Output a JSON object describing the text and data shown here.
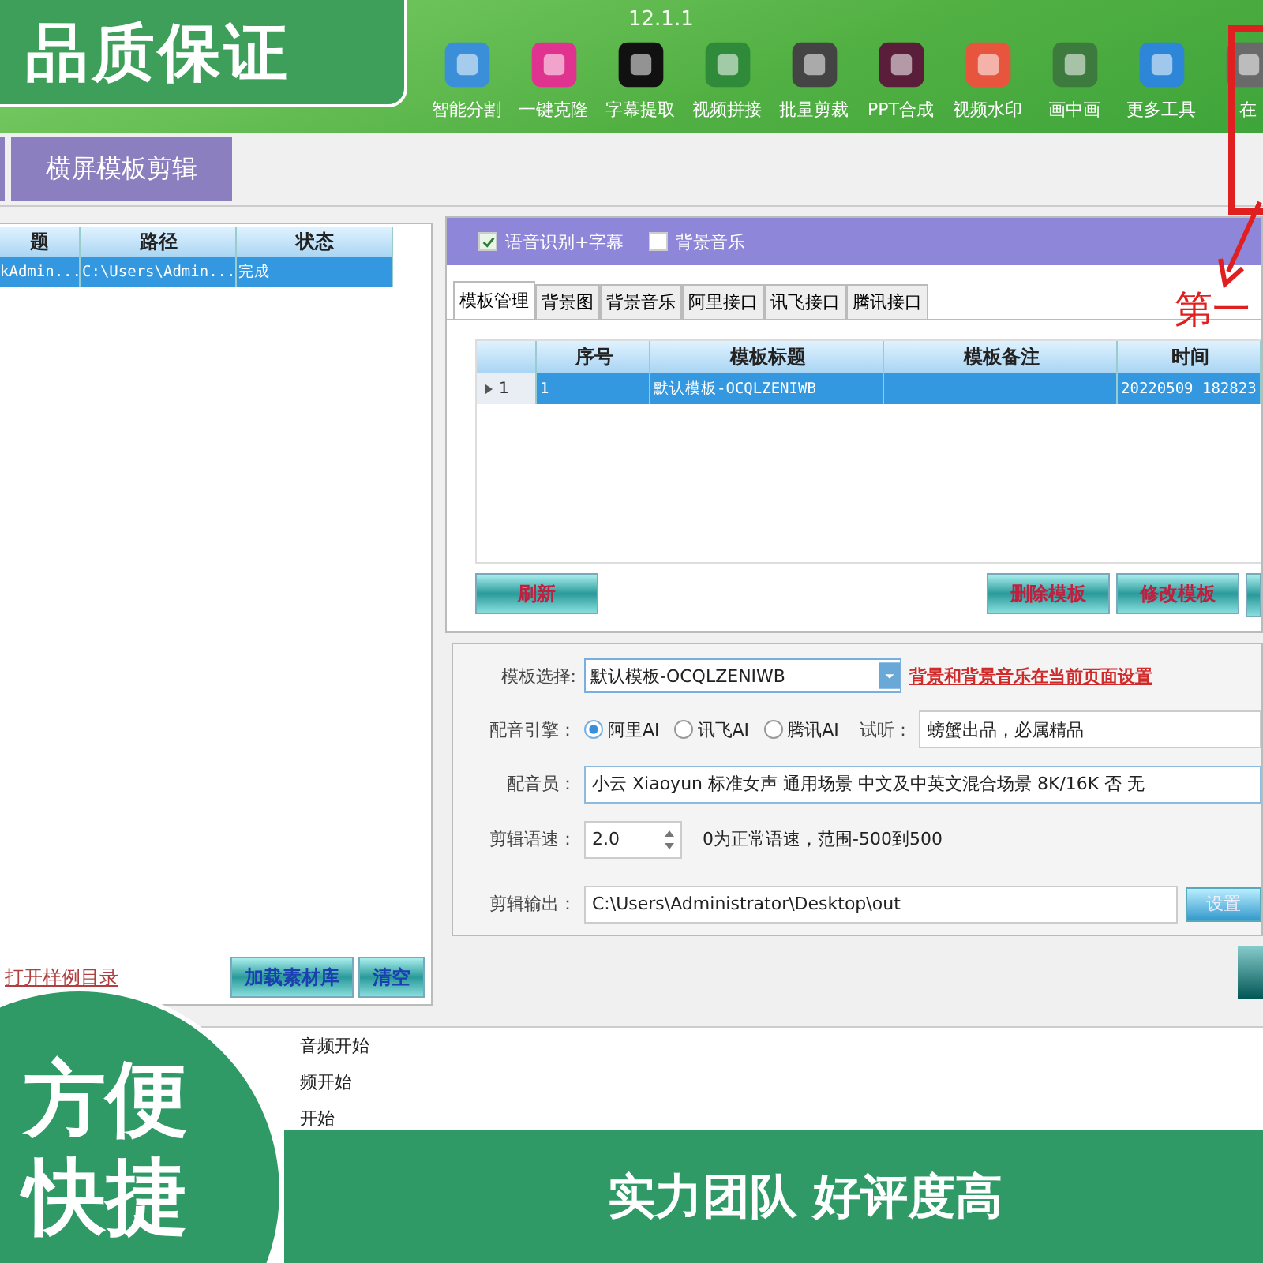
{
  "banner_top": {
    "text": "品质保证"
  },
  "toolbar": {
    "version": "12.1.1",
    "items": [
      {
        "label": "智能分割"
      },
      {
        "label": "一键克隆"
      },
      {
        "label": "字幕提取"
      },
      {
        "label": "视频拼接"
      },
      {
        "label": "批量剪裁"
      },
      {
        "label": "PPT合成"
      },
      {
        "label": "视频水印"
      },
      {
        "label": "画中画"
      },
      {
        "label": "更多工具"
      },
      {
        "label": "在"
      }
    ]
  },
  "mode_tabs": [
    {
      "label": "横屏模板剪辑",
      "selected": true
    }
  ],
  "file_table": {
    "columns": [
      "题",
      "路径",
      "状态"
    ],
    "rows": [
      {
        "cells": [
          "kAdmin...",
          "C:\\Users\\Admin...",
          "完成"
        ],
        "selected": true
      }
    ]
  },
  "sample_link": "打开样例目录",
  "file_buttons": [
    {
      "label": "加载素材库"
    },
    {
      "label": "清空"
    }
  ],
  "options": [
    {
      "label": "语音识别+字幕",
      "checked": true
    },
    {
      "label": "背景音乐",
      "checked": false
    }
  ],
  "panel_tabs": [
    {
      "label": "模板管理",
      "selected": true
    },
    {
      "label": "背景图",
      "selected": false
    },
    {
      "label": "背景音乐",
      "selected": false
    },
    {
      "label": "阿里接口",
      "selected": false
    },
    {
      "label": "讯飞接口",
      "selected": false
    },
    {
      "label": "腾讯接口",
      "selected": false
    }
  ],
  "template_table": {
    "columns": [
      "序号",
      "模板标题",
      "模板备注",
      "时间"
    ],
    "rows": [
      {
        "row_header": "1",
        "number": "1",
        "title": "默认模板-OCQLZENIWB",
        "time": "20220509 182823",
        "selected": true
      }
    ]
  },
  "template_buttons": [
    {
      "label": "刷新"
    },
    {
      "label": "删除模板"
    },
    {
      "label": "修改模板"
    }
  ],
  "template_select": {
    "label": "模板选择:",
    "value": "默认模板-OCQLZENIWB",
    "note": "背景和背景音乐在当前页面设置"
  },
  "engine": {
    "label": "配音引擎：",
    "options": [
      {
        "label": "阿里AI",
        "selected": true
      },
      {
        "label": "讯飞AI",
        "selected": false
      },
      {
        "label": "腾讯AI",
        "selected": false
      }
    ],
    "preview_label": "试听：",
    "preview_value": "螃蟹出品，必属精品"
  },
  "voice": {
    "label": "配音员：",
    "value": "小云 Xiaoyun 标准女声 通用场景 中文及中英文混合场景 8K/16K 否 无"
  },
  "speed": {
    "label": "剪辑语速：",
    "value": "2.0",
    "hint": "0为正常语速，范围-500到500"
  },
  "output": {
    "label": "剪辑输出：",
    "value": "C:\\Users\\Administrator\\Desktop\\out",
    "button": "设置"
  },
  "annotation": {
    "text": "第一"
  },
  "log_lines": [
    "音频开始",
    "频开始",
    "开始"
  ],
  "badge_circle": {
    "lines": [
      "方便",
      "快捷"
    ]
  },
  "banner_bottom": {
    "text": "实力团队 好评度高"
  }
}
